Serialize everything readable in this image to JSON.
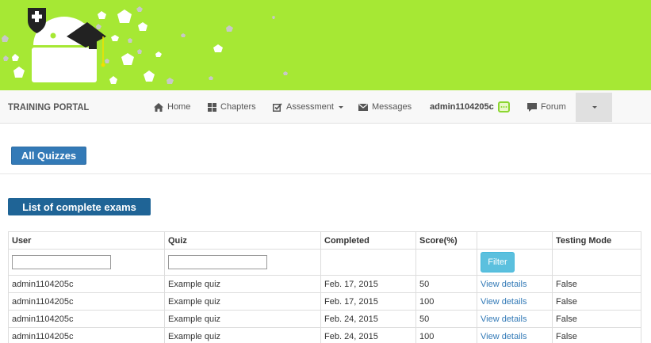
{
  "colors": {
    "banner": "#a6e834",
    "primary": "#337ab7",
    "dark_primary": "#1f6496",
    "info": "#5bc0de",
    "link": "#337ab7"
  },
  "navbar": {
    "brand": "TRAINING PORTAL",
    "items": [
      {
        "label": "Home",
        "icon": "home-icon"
      },
      {
        "label": "Chapters",
        "icon": "grid-icon"
      },
      {
        "label": "Assessment",
        "icon": "check-square-icon",
        "dropdown": true
      },
      {
        "label": "Messages",
        "icon": "envelope-icon"
      },
      {
        "label": "admin1104205c",
        "icon": "message-badge-icon"
      },
      {
        "label": "Forum",
        "icon": "comment-icon"
      }
    ],
    "more_icon": "caret-down-icon"
  },
  "buttons": {
    "all_quizzes": "All Quizzes",
    "list_complete": "List of complete exams",
    "filter": "Filter"
  },
  "table": {
    "headers": [
      "User",
      "Quiz",
      "Completed",
      "Score(%)",
      "",
      "Testing Mode"
    ],
    "rows": [
      {
        "user": "admin1104205c",
        "quiz": "Example quiz",
        "completed": "Feb. 17, 2015",
        "score": "50",
        "link": "View details",
        "mode": "False"
      },
      {
        "user": "admin1104205c",
        "quiz": "Example quiz",
        "completed": "Feb. 17, 2015",
        "score": "100",
        "link": "View details",
        "mode": "False"
      },
      {
        "user": "admin1104205c",
        "quiz": "Example quiz",
        "completed": "Feb. 24, 2015",
        "score": "50",
        "link": "View details",
        "mode": "False"
      },
      {
        "user": "admin1104205c",
        "quiz": "Example quiz",
        "completed": "Feb. 24, 2015",
        "score": "100",
        "link": "View details",
        "mode": "False"
      }
    ]
  }
}
